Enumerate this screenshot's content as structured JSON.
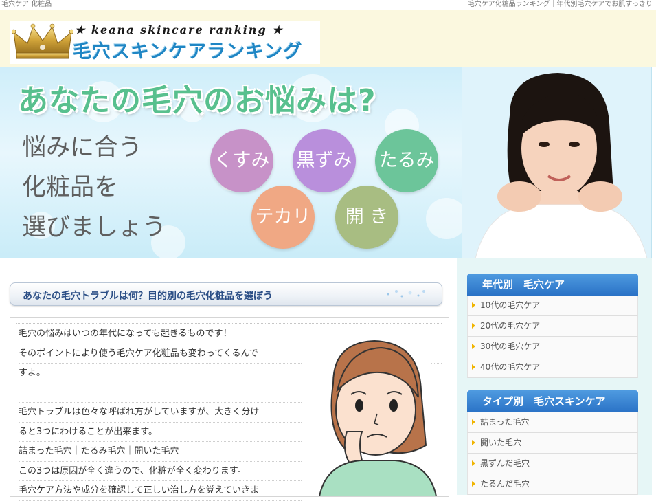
{
  "topbar": {
    "left": "毛穴ケア 化粧品",
    "right": "毛穴ケア化粧品ランキング｜年代別毛穴ケアでお肌すっきり"
  },
  "logo": {
    "subtitle": "★ keana skincare ranking ★",
    "title": "毛穴スキンケアランキング",
    "crown_icon": "crown-icon"
  },
  "hero": {
    "headline": "あなたの毛穴のお悩みは?",
    "lines": [
      "悩みに合う",
      "化粧品を",
      "選びましょう"
    ],
    "bubbles": [
      {
        "label": "くすみ",
        "color": "#c792c8"
      },
      {
        "label": "黒ずみ",
        "color": "#b98fdc"
      },
      {
        "label": "たるみ",
        "color": "#6cc59a"
      },
      {
        "label": "テカリ",
        "color": "#f0a884"
      },
      {
        "label": "開 き",
        "color": "#a8bd82"
      }
    ]
  },
  "main": {
    "section_title": "あなたの毛穴トラブルは何？目的別の毛穴化粧品を選ぼう",
    "lines": [
      "毛穴の悩みはいつの年代になっても起きるものです！",
      "そのポイントにより使う毛穴ケア化粧品も変わってくるんで",
      "すよ。",
      "",
      "毛穴トラブルは色々な呼ばれ方がしていますが、大きく分け",
      "ると3つにわけることが出来ます。",
      "詰まった毛穴｜たるみ毛穴｜開いた毛穴",
      "この3つは原因が全く違うので、化粧が全く変わります。",
      "毛穴ケア方法や成分を確認して正しい治し方を覚えていきま"
    ]
  },
  "sidebar": {
    "blocks": [
      {
        "title": "年代別　毛穴ケア",
        "items": [
          "10代の毛穴ケア",
          "20代の毛穴ケア",
          "30代の毛穴ケア",
          "40代の毛穴ケア"
        ]
      },
      {
        "title": "タイプ別　毛穴スキンケア",
        "items": [
          "詰まった毛穴",
          "開いた毛穴",
          "黒ずんだ毛穴",
          "たるんだ毛穴"
        ]
      }
    ]
  }
}
